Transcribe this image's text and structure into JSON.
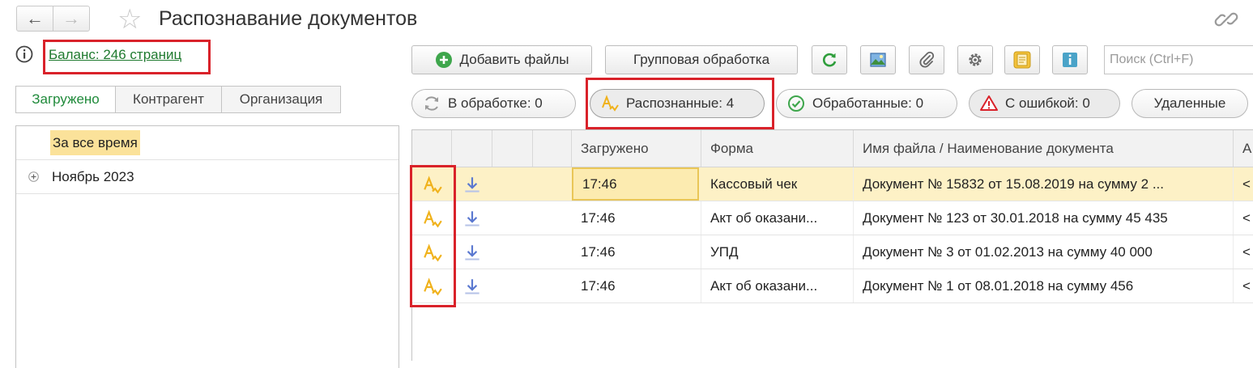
{
  "window": {
    "title": "Распознавание документов",
    "back_icon": "←",
    "forward_icon": "→",
    "favorite_icon": "☆"
  },
  "balance": {
    "link": "Баланс: 246 страниц"
  },
  "left_tabs": [
    {
      "label": "Загружено",
      "active": true
    },
    {
      "label": "Контрагент",
      "active": false
    },
    {
      "label": "Организация",
      "active": false
    }
  ],
  "periods": [
    {
      "label": "За все время",
      "selected": true
    },
    {
      "label": "Ноябрь 2023",
      "selected": false
    }
  ],
  "toolbar": {
    "add_files": "Добавить файлы",
    "group_processing": "Групповая обработка",
    "search_placeholder": "Поиск (Ctrl+F)"
  },
  "filters": [
    {
      "label": "В обработке: 0",
      "icon": "refresh-icon"
    },
    {
      "label": "Распознанные: 4",
      "icon": "recognized-icon",
      "active": true
    },
    {
      "label": "Обработанные: 0",
      "icon": "check-circle-icon"
    },
    {
      "label": "С ошибкой: 0",
      "icon": "warning-icon"
    },
    {
      "label": "Удаленные",
      "icon": ""
    }
  ],
  "table": {
    "columns": [
      "",
      "",
      "",
      "",
      "Загружено",
      "Форма",
      "Имя файла / Наименование документа",
      "А"
    ],
    "rows": [
      {
        "loaded": "17:46",
        "form": "Кассовый чек",
        "name": "Документ № 15832 от 15.08.2019 на сумму 2 ...",
        "extra": "<",
        "selected": true
      },
      {
        "loaded": "17:46",
        "form": "Акт об оказани...",
        "name": "Документ № 123 от 30.01.2018 на сумму 45 435",
        "extra": "<",
        "selected": false
      },
      {
        "loaded": "17:46",
        "form": "УПД",
        "name": "Документ № 3 от 01.02.2013 на сумму 40 000",
        "extra": "<",
        "selected": false
      },
      {
        "loaded": "17:46",
        "form": "Акт об оказани...",
        "name": "Документ № 1 от 08.01.2018 на сумму 456",
        "extra": "<",
        "selected": false
      }
    ]
  },
  "colors": {
    "highlight_red": "#d9222a",
    "link_green": "#1f7a2f",
    "selection_yellow": "#fdf1c6",
    "recognized_icon": "#f0b21c",
    "download_icon": "#5a78d0"
  }
}
